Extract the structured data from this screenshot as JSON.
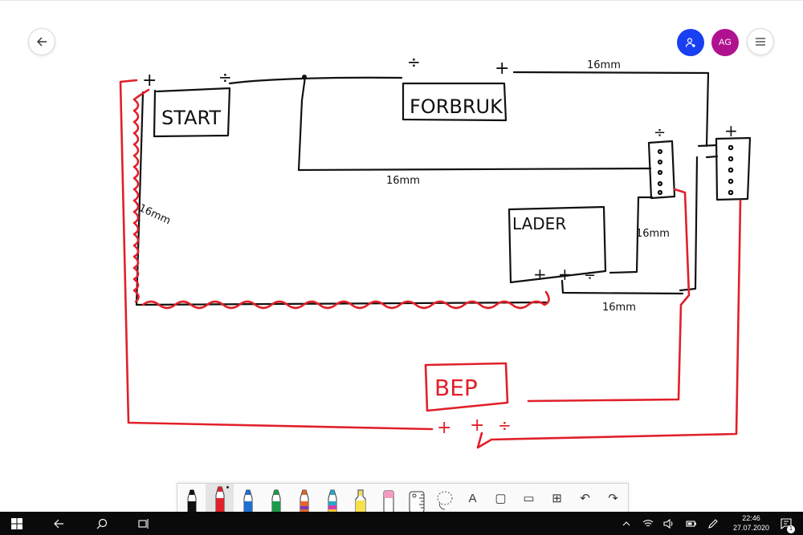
{
  "header": {
    "back_icon": "arrow-left-icon",
    "share_icon": "person-add-icon",
    "avatar_initials": "AG",
    "avatar_color": "#b0128f",
    "share_color": "#1a3ff2",
    "menu_icon": "hamburger-icon"
  },
  "drawing": {
    "labels": {
      "start": "START",
      "forbruk": "FORBRUK",
      "lader": "LADER",
      "bep": "BEP",
      "cable_top": "16mm",
      "cable_mid": "16mm",
      "cable_left": "16mm",
      "cable_right": "16mm",
      "cable_bottom": "16mm",
      "plus": "+",
      "minus": "÷"
    },
    "ink_colors": {
      "black": "#111111",
      "red": "#e0202a"
    }
  },
  "toolbar": {
    "tools": [
      {
        "name": "pen-black-tool",
        "color": "#111111"
      },
      {
        "name": "pen-red-tool",
        "color": "#e0202a",
        "selected": true
      },
      {
        "name": "pen-blue-tool",
        "color": "#1f6fd1"
      },
      {
        "name": "pen-green-tool",
        "color": "#1b9a4a"
      },
      {
        "name": "pen-galaxy-tool",
        "color": "#e2662e"
      },
      {
        "name": "pen-rainbow-tool",
        "color": "#2aa7c4"
      },
      {
        "name": "highlighter-yellow-tool",
        "color": "#f6e04c"
      },
      {
        "name": "eraser-tool",
        "color": "#f29cc2"
      },
      {
        "name": "ruler-tool",
        "color": "#e8e8e8"
      },
      {
        "name": "lasso-tool",
        "color": "#777777"
      }
    ],
    "actions": [
      {
        "name": "text-tool",
        "glyph": "A"
      },
      {
        "name": "sticky-note-tool",
        "glyph": "▢"
      },
      {
        "name": "image-tool",
        "glyph": "▭"
      },
      {
        "name": "add-tool",
        "glyph": "⊞"
      },
      {
        "name": "undo-button",
        "glyph": "↶"
      },
      {
        "name": "redo-button",
        "glyph": "↷"
      }
    ]
  },
  "taskbar": {
    "time": "22:46",
    "date": "27.07.2020",
    "notification_count": "1"
  }
}
